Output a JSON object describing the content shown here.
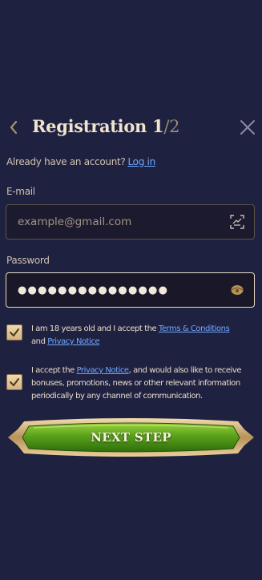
{
  "header": {
    "title": "Registration 1",
    "step_total": "/2"
  },
  "account": {
    "prompt": "Already have an account?",
    "login_link": "Log in"
  },
  "email": {
    "label": "E-mail",
    "placeholder": "example@gmail.com",
    "value": ""
  },
  "password": {
    "label": "Password",
    "value": "●●●●●●●●●●●●●●●"
  },
  "consents": [
    {
      "checked": true,
      "text_before": "I am 18 years old and I accept the ",
      "link1": "Terms & Conditions",
      "text_middle": " and ",
      "link2": "Privacy Notice"
    },
    {
      "checked": true,
      "text_before": "I accept the ",
      "link1": "Privacy Notice",
      "text_after": ", and would also like to receive bonuses, promotions, news or other relevant information periodically by any channel of communication."
    }
  ],
  "next_button": {
    "label": "NEXT STEP"
  },
  "colors": {
    "background": "#1f2141",
    "gold": "#a8916a",
    "link": "#6fa8ff",
    "button_green": "#5aa11a"
  }
}
